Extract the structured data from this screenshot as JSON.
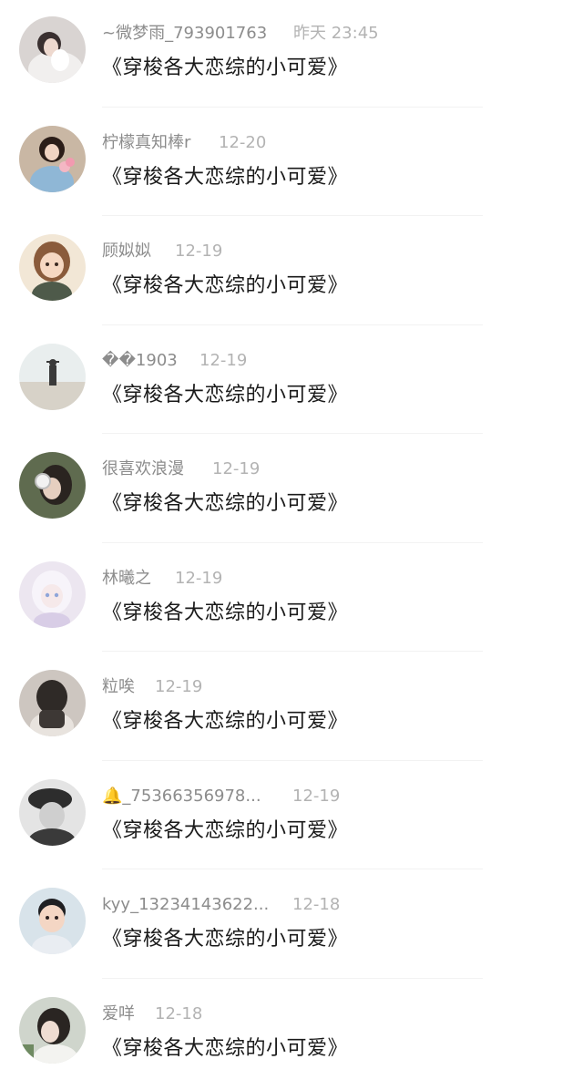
{
  "comments": [
    {
      "name": "~微梦雨_793901763",
      "time": "昨天 23:45",
      "text": "《穿梭各大恋综的小可爱》"
    },
    {
      "name": "柠檬真知棒r",
      "time": "12-20",
      "text": "《穿梭各大恋综的小可爱》"
    },
    {
      "name": "顾姒姒",
      "time": "12-19",
      "text": "《穿梭各大恋综的小可爱》"
    },
    {
      "name": "��1903",
      "time": "12-19",
      "text": "《穿梭各大恋综的小可爱》"
    },
    {
      "name": "很喜欢浪漫",
      "time": "12-19",
      "text": "《穿梭各大恋综的小可爱》"
    },
    {
      "name": "林曦之",
      "time": "12-19",
      "text": "《穿梭各大恋综的小可爱》"
    },
    {
      "name": "粒唉",
      "time": "12-19",
      "text": "《穿梭各大恋综的小可爱》"
    },
    {
      "name": "🔔_75366356978...",
      "time": "12-19",
      "text": "《穿梭各大恋综的小可爱》"
    },
    {
      "name": "kyy_13234143622...",
      "time": "12-18",
      "text": "《穿梭各大恋综的小可爱》"
    },
    {
      "name": "爱咩",
      "time": "12-18",
      "text": "《穿梭各大恋综的小可爱》"
    }
  ]
}
